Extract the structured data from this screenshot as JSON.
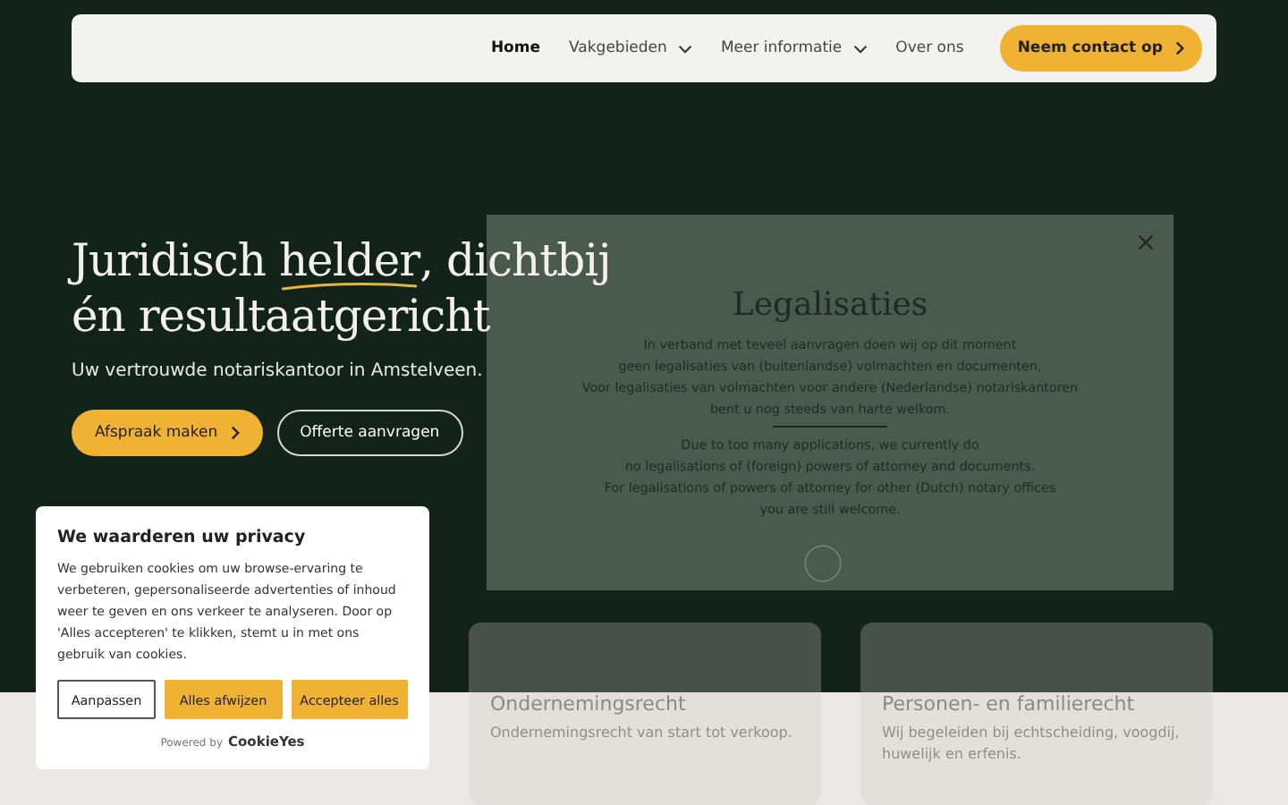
{
  "nav": {
    "items": [
      {
        "label": "Home",
        "selected": true,
        "dropdown": false
      },
      {
        "label": "Vakgebieden",
        "selected": false,
        "dropdown": true
      },
      {
        "label": "Meer informatie",
        "selected": false,
        "dropdown": true
      },
      {
        "label": "Over ons",
        "selected": false,
        "dropdown": false
      }
    ],
    "cta": "Neem contact op"
  },
  "hero": {
    "title_line_1_pre": "Juridisch ",
    "title_highlight": "helder",
    "title_line_1_post": ", dichtbij",
    "title_line_2": "én resultaatgericht",
    "subtitle": "Uw vertrouwde notariskantoor in Amstelveen.",
    "primary_button": "Afspraak maken",
    "secondary_button": "Offerte aanvragen"
  },
  "modal": {
    "title": "Legalisaties",
    "dutch_lines": [
      "In verband met teveel aanvragen doen wij op dit moment",
      "geen legalisaties van (buitenlandse) volmachten en documenten,",
      "Voor legalisaties van volmachten voor andere (Nederlandse) notariskantoren",
      "bent u nog steeds van harte welkom."
    ],
    "english_lines": [
      "Due to too many applications, we currently do",
      "no legalisations of (foreign) powers of attorney and documents.",
      "For legalisations of powers of attorney for other (Dutch) notary offices",
      "you are still welcome."
    ]
  },
  "cards": [
    {
      "title": "Ondernemingsrecht",
      "text": "Ondernemingsrecht van start tot verkoop."
    },
    {
      "title": "Personen- en familierecht",
      "text": "Wij begeleiden bij echtscheiding, voogdij, huwelijk en erfenis."
    }
  ],
  "cookie": {
    "title": "We waarderen uw privacy",
    "text": "We gebruiken cookies om uw browse-ervaring te verbeteren, gepersonaliseerde advertenties of inhoud weer te geven en ons verkeer te analyseren. Door op 'Alles accepteren' te klikken, stemt u in met ons gebruik van cookies.",
    "buttons": [
      {
        "label": "Aanpassen",
        "kind": "outline"
      },
      {
        "label": "Alles afwijzen",
        "kind": "filled"
      },
      {
        "label": "Accepteer alles",
        "kind": "filled"
      }
    ],
    "powered_by": "Powered by",
    "brand": "CookieYes"
  }
}
